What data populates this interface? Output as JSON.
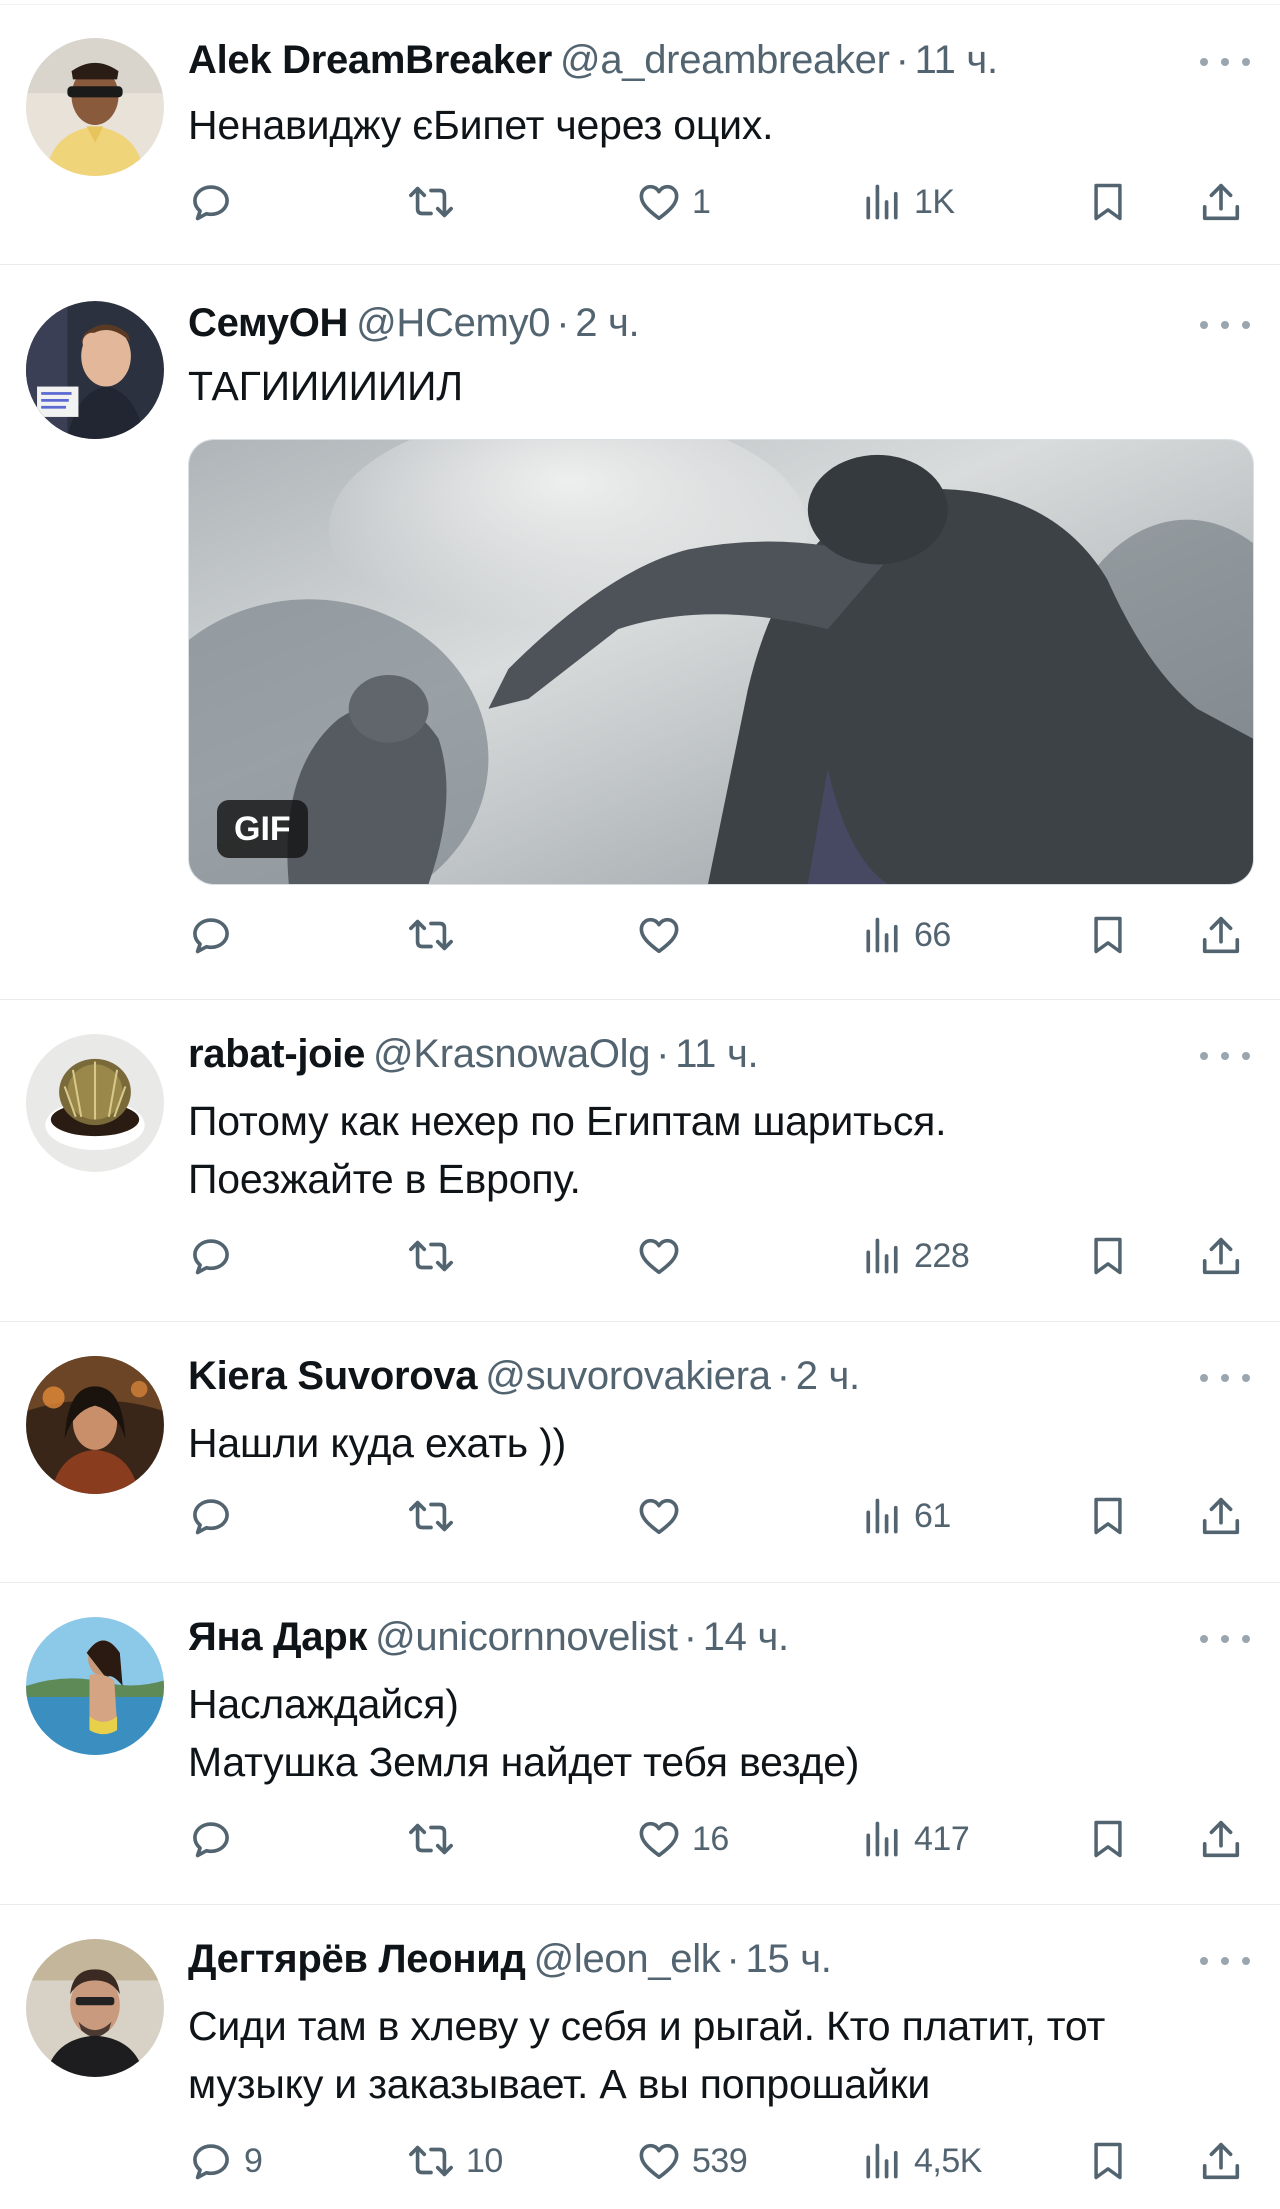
{
  "tweets": [
    {
      "name": "Alek DreamBreaker",
      "handle": "@a_dreambreaker",
      "time": "11 ч.",
      "lines": [
        "Ненавиджу єБипет через оцих."
      ],
      "replies": "",
      "retweets": "",
      "likes": "1",
      "views": "1K"
    },
    {
      "name": "СемуОН",
      "handle": "@HCemy0",
      "time": "2 ч.",
      "lines": [
        "ТАГИИИИИИЛ"
      ],
      "media_badge": "GIF",
      "replies": "",
      "retweets": "",
      "likes": "",
      "views": "66"
    },
    {
      "name": "rabat-joie",
      "handle": "@KrasnowaOlg",
      "time": "11 ч.",
      "lines": [
        "Потому как нехер по Египтам шариться.",
        "Поезжайте в Европу."
      ],
      "replies": "",
      "retweets": "",
      "likes": "",
      "views": "228"
    },
    {
      "name": "Kiera Suvorova",
      "handle": "@suvorovakiera",
      "time": "2 ч.",
      "lines": [
        "Нашли куда ехать ))"
      ],
      "replies": "",
      "retweets": "",
      "likes": "",
      "views": "61"
    },
    {
      "name": "Яна Дарк",
      "handle": "@unicornnovelist",
      "time": "14 ч.",
      "lines": [
        "Наслаждайся)",
        "Матушка Земля найдет тебя везде)"
      ],
      "replies": "",
      "retweets": "",
      "likes": "16",
      "views": "417"
    },
    {
      "name": "Дегтярёв Леонид",
      "handle": "@leon_elk",
      "time": "15 ч.",
      "lines": [
        "Сиди там в хлеву у себя и рыгай. Кто платит, тот",
        "музыку и заказывает. А вы попрошайки"
      ],
      "replies": "9",
      "retweets": "10",
      "likes": "539",
      "views": "4,5K"
    }
  ],
  "icons": {
    "reply": "reply-icon",
    "retweet": "retweet-icon",
    "like": "heart-icon",
    "views": "views-icon",
    "bookmark": "bookmark-icon",
    "share": "share-icon",
    "more": "more-icon"
  },
  "colors": {
    "text": "#0f1419",
    "muted": "#536471",
    "divider": "#e7ebed"
  }
}
